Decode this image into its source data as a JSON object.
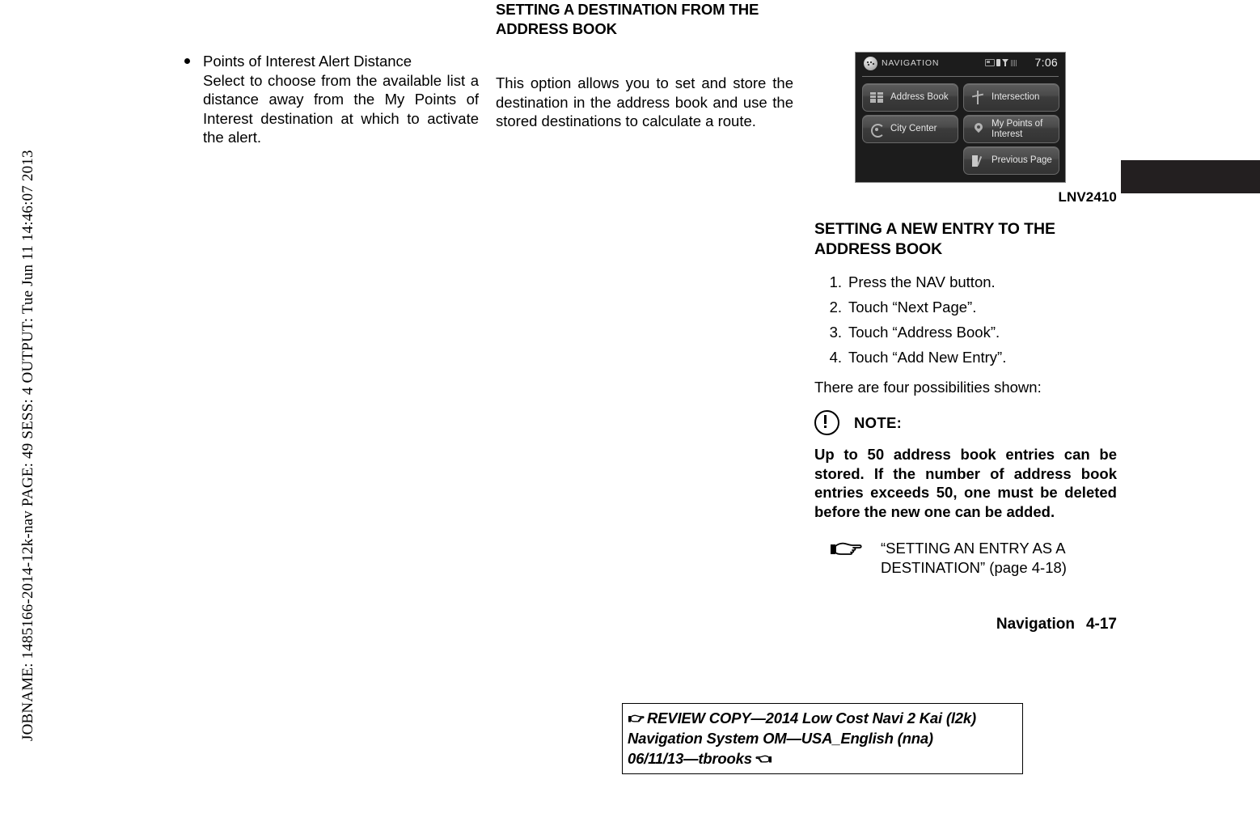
{
  "jobname_strip": "JOBNAME: 1485166-2014-12k-nav  PAGE: 49  SESS: 4  OUTPUT: Tue Jun 11 14:46:07 2013",
  "column1": {
    "bullet": {
      "title": "Points of Interest Alert Distance",
      "body": "Select to choose from the available list a distance away from the My Points of Interest destination at which to activate the alert."
    }
  },
  "column2": {
    "heading": "SETTING A DESTINATION FROM THE ADDRESS BOOK",
    "body": "This option allows you to set and store the destination in the address book and use the stored destinations to calculate a route."
  },
  "nav_screen": {
    "title": "NAVIGATION",
    "time": "7:06",
    "status_icons": [
      "battery-icon",
      "phone-icon",
      "signal-icon"
    ],
    "buttons": [
      {
        "label": "Address Book",
        "icon": "address-book-icon"
      },
      {
        "label": "Intersection",
        "icon": "intersection-icon"
      },
      {
        "label": "City Center",
        "icon": "city-center-icon"
      },
      {
        "label": "My Points of Interest",
        "icon": "map-pin-icon"
      },
      {
        "label": "Previous Page",
        "icon": "previous-page-icon"
      }
    ]
  },
  "figure_caption": "LNV2410",
  "column3": {
    "heading": "SETTING A NEW ENTRY TO THE ADDRESS BOOK",
    "steps": [
      "Press the NAV button.",
      "Touch “Next Page”.",
      "Touch “Address Book”.",
      "Touch “Add New Entry”."
    ],
    "possibilities": "There are four possibilities shown:",
    "note_label": "NOTE:",
    "note_body": "Up to 50 address book entries can be stored. If the number of address book entries exceeds 50, one must be deleted before the new one can be added.",
    "xref": "“SETTING AN ENTRY AS A DESTINATION” (page 4-18)",
    "footer_section": "Navigation",
    "footer_page": "4-17"
  },
  "review_box": {
    "line1": "REVIEW COPY—2014 Low Cost Navi 2 Kai (l2k)",
    "line2": "Navigation System OM—USA_English (nna)",
    "line3": "06/11/13—tbrooks"
  }
}
